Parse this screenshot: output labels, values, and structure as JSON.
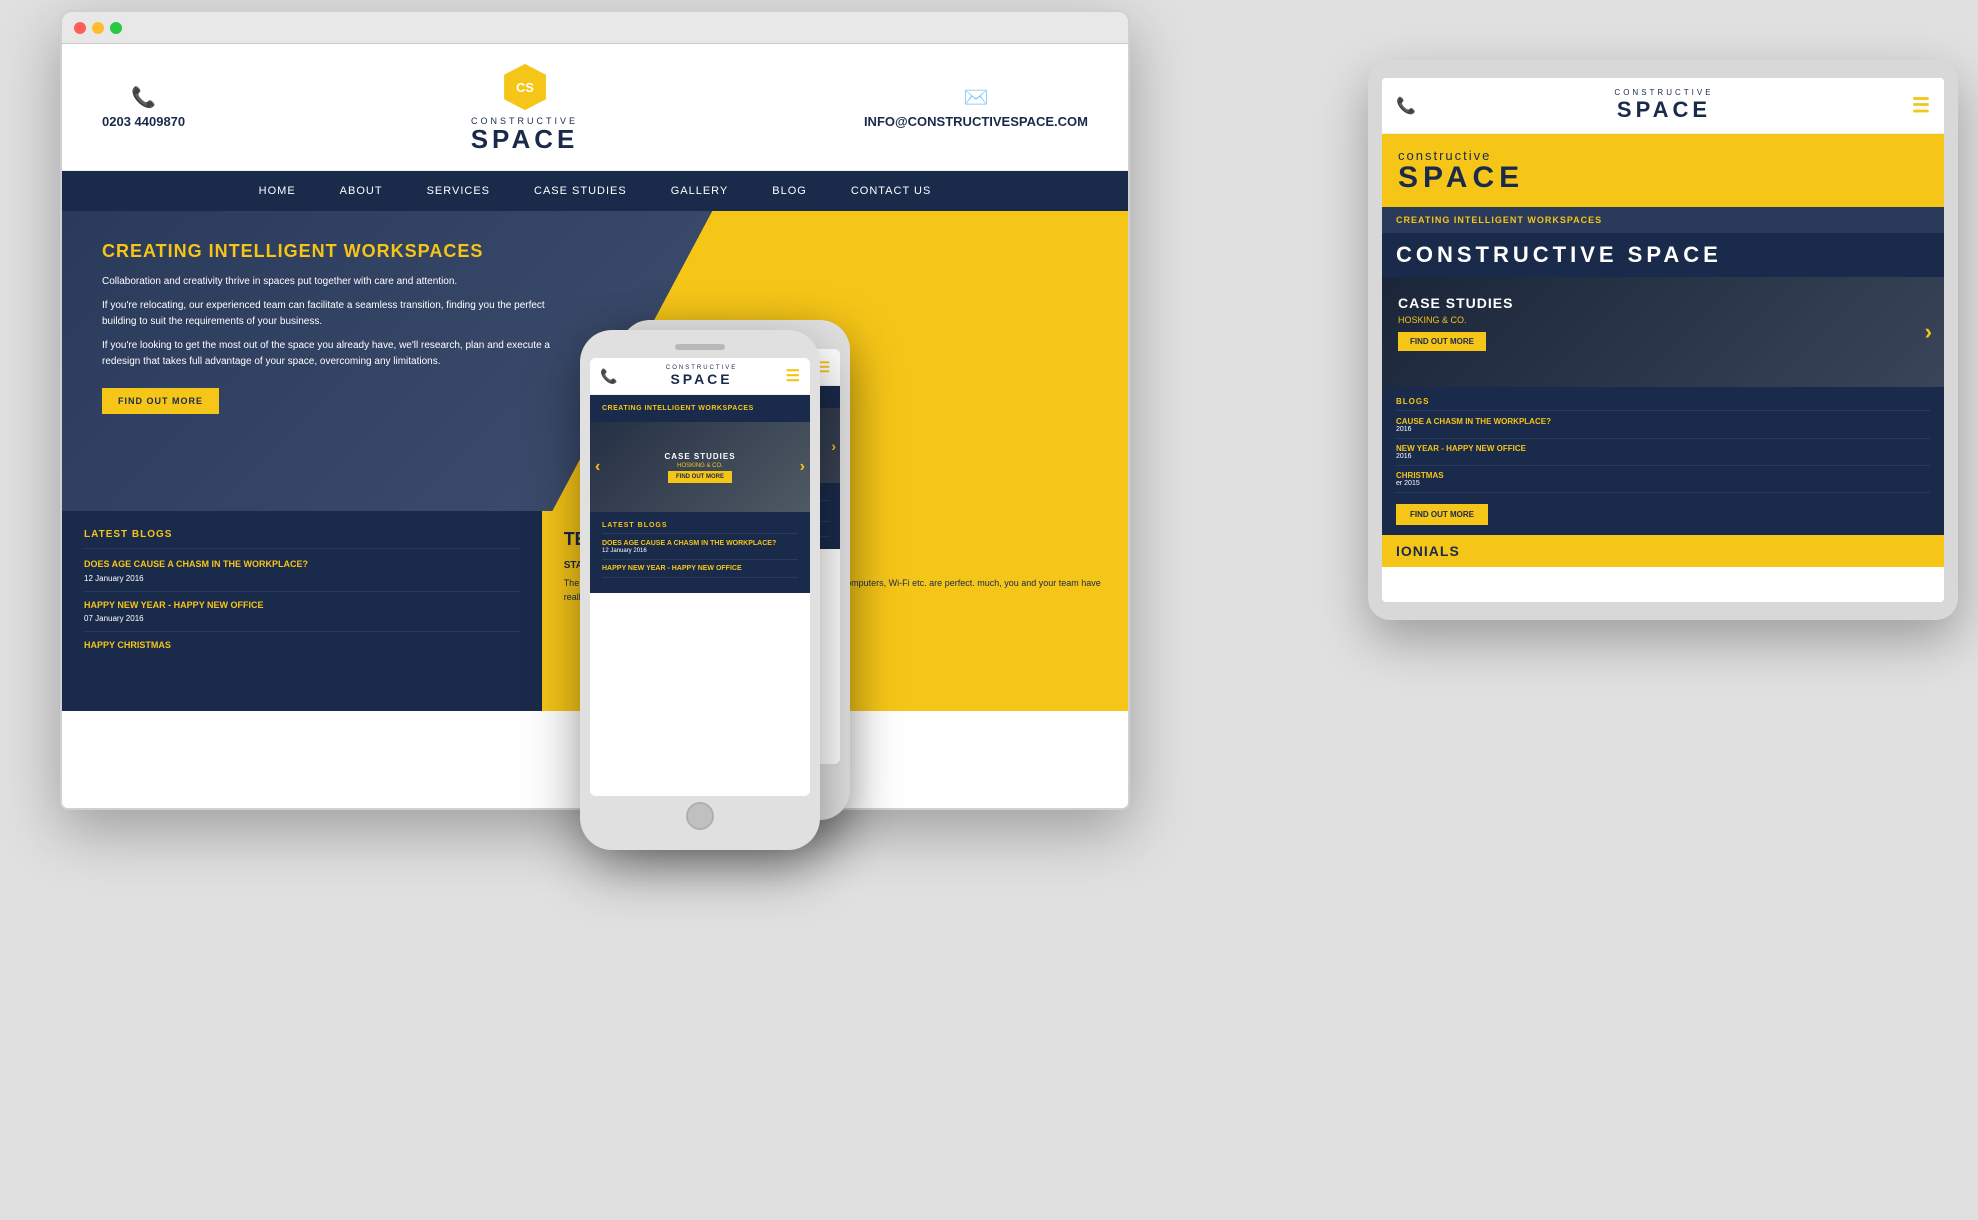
{
  "scene": {
    "background_color": "#e0e0e0"
  },
  "brand": {
    "name_small": "CONSTRUCTIVE",
    "name_large": "SPACE",
    "phone": "0203 4409870",
    "email": "INFO@CONSTRUCTIVESPACE.COM",
    "accent_color": "#f5c518",
    "dark_color": "#1a2a4a"
  },
  "nav": {
    "items": [
      "HOME",
      "ABOUT",
      "SERVICES",
      "CASE STUDIES",
      "GALLERY",
      "BLOG",
      "CONTACT US"
    ]
  },
  "hero": {
    "title": "CREATING INTELLIGENT WORKSPACES",
    "paragraph1": "Collaboration and creativity thrive in spaces put together with care and attention.",
    "paragraph2": "If you're relocating, our experienced team can facilitate a seamless transition, finding you the perfect building to suit the requirements of your business.",
    "paragraph3": "If you're looking to get the most out of the space you already have, we'll research, plan and execute a redesign that takes full advantage of your space, overcoming any limitations.",
    "cta_button": "FIND OUT MORE"
  },
  "blogs": {
    "section_title": "LATEST BLOGS",
    "items": [
      {
        "title": "DOES AGE CAUSE A CHASM IN THE WORKPLACE?",
        "date": "12 January 2016"
      },
      {
        "title": "HAPPY NEW YEAR - HAPPY NEW OFFICE",
        "date": "07 January 2016"
      },
      {
        "title": "HAPPY CHRISTMAS",
        "date": ""
      }
    ]
  },
  "testimonials": {
    "section_title": "TESTIMONIALS",
    "author": "STACEY RAYMOND, OFFICE MANAGER, TISO B",
    "text": "The office looks absolutely wonderful, everything re and I am thrilled. Computers, Wi-Fi etc. are perfect. much, you and your team have really out done them"
  },
  "case_studies": {
    "title": "CASE STUDIES",
    "subtitle": "HOSKING & CO.",
    "button": "FIND OUT MORE"
  },
  "constructive_space_banner": {
    "line1": "constructive",
    "line2": "SPACE"
  },
  "desktop_label": "CONSTRUCTIVE SPACE",
  "tablet_right_label": "CONSTRUCTIVE SPACE"
}
